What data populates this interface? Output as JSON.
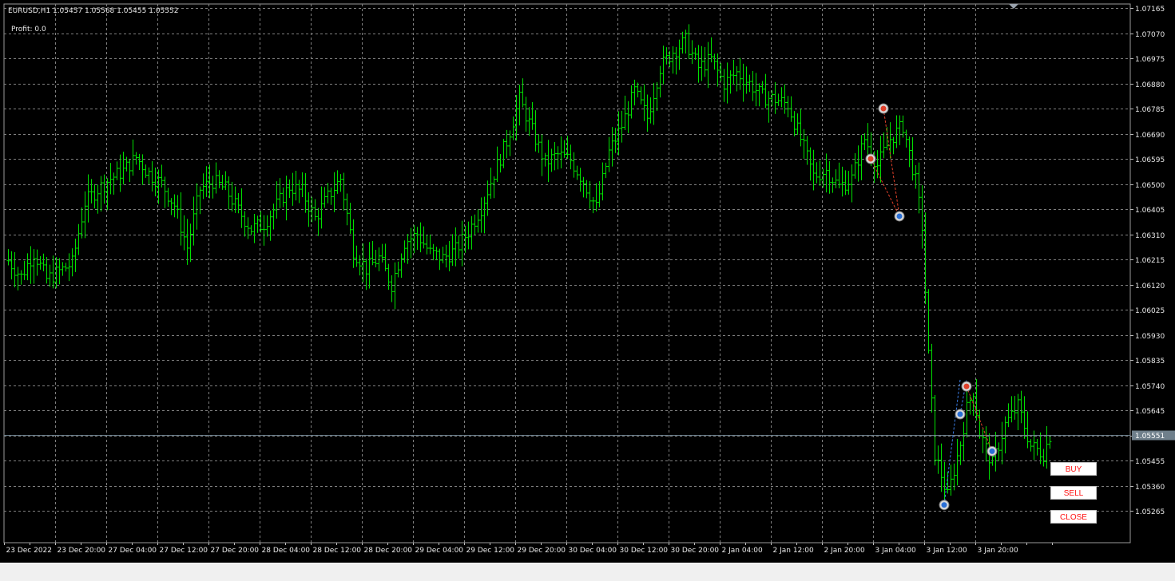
{
  "header": {
    "symbol_line": "EURUSD,H1  1.05457 1.05568 1.05455 1.05552",
    "profit_label": "Profit: 0.0"
  },
  "buttons": {
    "buy": "BUY",
    "sell": "SELL",
    "close": "CLOSE"
  },
  "current_price_label": "1.05551",
  "colors": {
    "background": "#000000",
    "bars": "#00e000",
    "grid": "#7f7f7f",
    "axis_text": "#e8e8e8",
    "button_text": "#ff1010",
    "price_line": "#6a7d8a"
  },
  "chart_data": {
    "type": "ohlc",
    "symbol": "EURUSD",
    "timeframe": "H1",
    "ylim": [
      1.0521,
      1.07165
    ],
    "y_ticks": [
      "1.07165",
      "1.07070",
      "1.06975",
      "1.06880",
      "1.06785",
      "1.06690",
      "1.06595",
      "1.06500",
      "1.06405",
      "1.06310",
      "1.06215",
      "1.06120",
      "1.06025",
      "1.05930",
      "1.05835",
      "1.05740",
      "1.05645",
      "1.05550",
      "1.05455",
      "1.05360",
      "1.05265"
    ],
    "x_ticks": [
      "23 Dec 2022",
      "23 Dec 20:00",
      "27 Dec 04:00",
      "27 Dec 12:00",
      "27 Dec 20:00",
      "28 Dec 04:00",
      "28 Dec 12:00",
      "28 Dec 20:00",
      "29 Dec 04:00",
      "29 Dec 12:00",
      "29 Dec 20:00",
      "30 Dec 04:00",
      "30 Dec 12:00",
      "30 Dec 20:00",
      "2 Jan 04:00",
      "2 Jan 12:00",
      "2 Jan 20:00",
      "3 Jan 04:00",
      "3 Jan 12:00",
      "3 Jan 20:00"
    ],
    "grid": true,
    "close_anchors": [
      [
        0,
        1.0621
      ],
      [
        4,
        1.0615
      ],
      [
        8,
        1.0624
      ],
      [
        12,
        1.0614
      ],
      [
        16,
        1.0617
      ],
      [
        20,
        1.062
      ],
      [
        24,
        1.0643
      ],
      [
        28,
        1.0648
      ],
      [
        32,
        1.0652
      ],
      [
        36,
        1.0655
      ],
      [
        40,
        1.066
      ],
      [
        44,
        1.0654
      ],
      [
        48,
        1.065
      ],
      [
        52,
        1.0642
      ],
      [
        56,
        1.0626
      ],
      [
        60,
        1.0648
      ],
      [
        64,
        1.0651
      ],
      [
        68,
        1.0648
      ],
      [
        72,
        1.064
      ],
      [
        76,
        1.0633
      ],
      [
        80,
        1.0635
      ],
      [
        84,
        1.0642
      ],
      [
        88,
        1.0649
      ],
      [
        92,
        1.0647
      ],
      [
        96,
        1.0637
      ],
      [
        100,
        1.0645
      ],
      [
        104,
        1.0652
      ],
      [
        108,
        1.0625
      ],
      [
        112,
        1.0618
      ],
      [
        116,
        1.0622
      ],
      [
        120,
        1.0612
      ],
      [
        124,
        1.0628
      ],
      [
        128,
        1.0631
      ],
      [
        132,
        1.0624
      ],
      [
        136,
        1.0622
      ],
      [
        140,
        1.0625
      ],
      [
        144,
        1.0632
      ],
      [
        148,
        1.0641
      ],
      [
        152,
        1.0654
      ],
      [
        156,
        1.0666
      ],
      [
        160,
        1.0682
      ],
      [
        164,
        1.067
      ],
      [
        168,
        1.0658
      ],
      [
        172,
        1.0661
      ],
      [
        176,
        1.0659
      ],
      [
        180,
        1.0651
      ],
      [
        184,
        1.0641
      ],
      [
        188,
        1.0662
      ],
      [
        192,
        1.0672
      ],
      [
        196,
        1.0685
      ],
      [
        200,
        1.0675
      ],
      [
        204,
        1.0694
      ],
      [
        208,
        1.07
      ],
      [
        212,
        1.0704
      ],
      [
        216,
        1.0694
      ],
      [
        220,
        1.0697
      ],
      [
        224,
        1.0688
      ],
      [
        228,
        1.0692
      ],
      [
        232,
        1.0688
      ],
      [
        236,
        1.0683
      ],
      [
        240,
        1.0682
      ],
      [
        244,
        1.068
      ],
      [
        248,
        1.0667
      ],
      [
        252,
        1.0653
      ],
      [
        256,
        1.0655
      ],
      [
        260,
        1.0649
      ],
      [
        264,
        1.0652
      ],
      [
        268,
        1.0667
      ],
      [
        272,
        1.0657
      ],
      [
        276,
        1.0667
      ],
      [
        280,
        1.0672
      ],
      [
        284,
        1.0651
      ],
      [
        286,
        1.0634
      ],
      [
        288,
        1.0585
      ],
      [
        290,
        1.0548
      ],
      [
        294,
        1.0532
      ],
      [
        298,
        1.0552
      ],
      [
        300,
        1.0565
      ],
      [
        302,
        1.0572
      ],
      [
        304,
        1.0556
      ],
      [
        308,
        1.0544
      ],
      [
        312,
        1.0559
      ],
      [
        316,
        1.0566
      ],
      [
        320,
        1.0551
      ],
      [
        324,
        1.0548
      ],
      [
        326,
        1.0555
      ]
    ],
    "current_price": 1.05551,
    "trades": [
      {
        "kind": "sell",
        "entry_bar": 270,
        "entry": 1.06595,
        "exit_bar": 279,
        "exit": 1.06378
      },
      {
        "kind": "sell",
        "entry_bar": 274,
        "entry": 1.06785,
        "exit_bar": 279,
        "exit": 1.06378
      },
      {
        "kind": "buy",
        "entry_bar": 293,
        "entry": 1.05287,
        "exit_bar": 298,
        "exit": 1.0576
      },
      {
        "kind": "sell",
        "entry_bar": 300,
        "entry": 1.05735,
        "exit_bar": 308,
        "exit": 1.0549
      },
      {
        "kind": "buy",
        "entry_bar": 298,
        "entry": 1.0563,
        "exit_bar": 300,
        "exit": 1.0576
      }
    ]
  }
}
